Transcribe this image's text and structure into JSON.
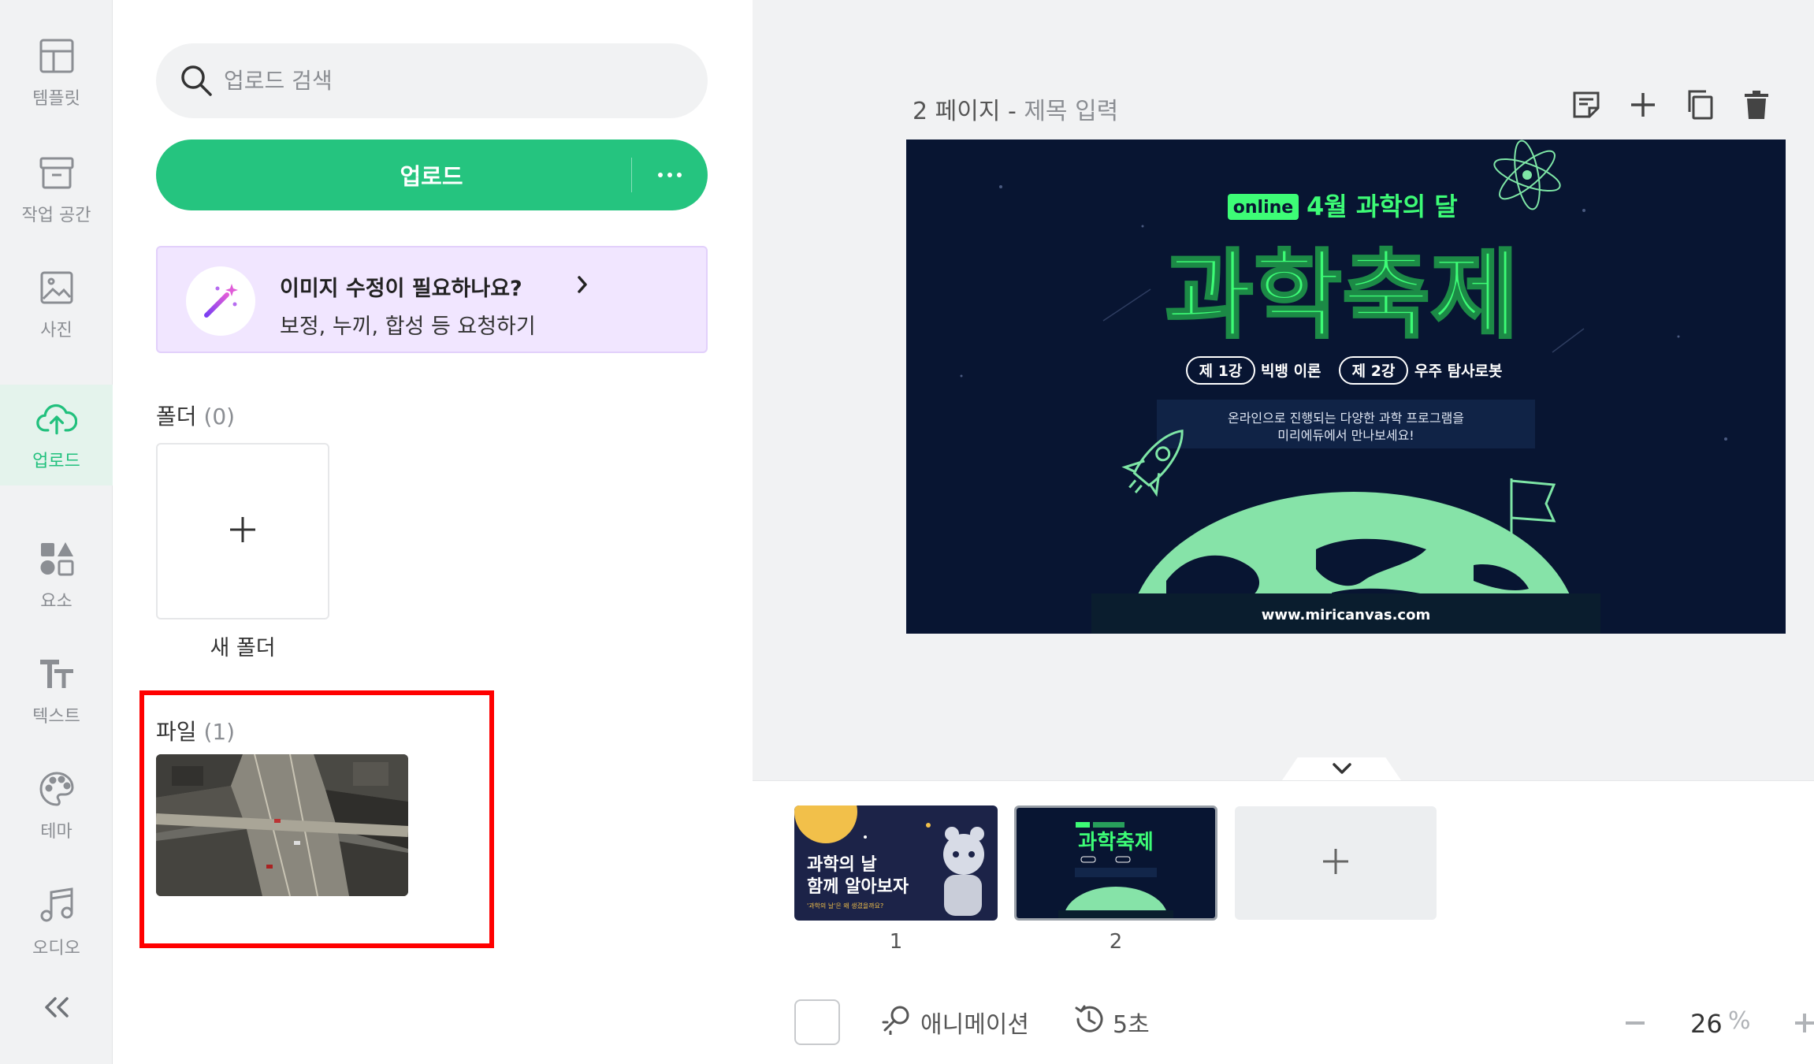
{
  "nav": {
    "items": [
      {
        "label": "템플릿",
        "icon": "template-icon"
      },
      {
        "label": "작업 공간",
        "icon": "archive-icon"
      },
      {
        "label": "사진",
        "icon": "image-icon"
      },
      {
        "label": "업로드",
        "icon": "cloud-upload-icon",
        "active": true
      },
      {
        "label": "요소",
        "icon": "shapes-icon"
      },
      {
        "label": "텍스트",
        "icon": "text-icon"
      },
      {
        "label": "테마",
        "icon": "palette-icon"
      },
      {
        "label": "오디오",
        "icon": "music-icon"
      }
    ],
    "collapse_icon": "double-chevron-left-icon"
  },
  "panel": {
    "search_placeholder": "업로드 검색",
    "upload_label": "업로드",
    "promo_title": "이미지 수정이 필요하나요?",
    "promo_sub": "보정, 누끼, 합성 등 요청하기",
    "folders_title": "폴더",
    "folders_count": "(0)",
    "new_folder_label": "새 폴더",
    "files_title": "파일",
    "files_count": "(1)"
  },
  "canvas": {
    "page_label": "2 페이지 - ",
    "title_placeholder": "제목 입력",
    "toolbar": [
      "memo-icon",
      "add-page-icon",
      "duplicate-icon",
      "trash-icon"
    ]
  },
  "slide": {
    "badge": "online",
    "subtitle": "4월 과학의 달",
    "title": "과학축제",
    "lecture1_tag": "제 1강",
    "lecture1": "빅뱅 이론",
    "lecture2_tag": "제 2강",
    "lecture2": "우주 탐사로봇",
    "desc1": "온라인으로 진행되는 다양한 과학 프로그램을",
    "desc2": "미리에듀에서 만나보세요!",
    "url": "www.miricanvas.com"
  },
  "thumbnails": {
    "slide1_line1": "과학의 날",
    "slide1_line2": "함께 알아보자",
    "slide1_foot": "'과학의 날'은 왜 생겼을까요?",
    "slide2_title": "과학축제",
    "numbers": [
      "1",
      "2"
    ]
  },
  "bottom": {
    "animation_label": "애니메이션",
    "duration_label": "5초",
    "zoom_value": "26",
    "zoom_unit": "%"
  },
  "colors": {
    "brand_green": "#25c47f",
    "slide_bg": "#081532",
    "slide_accent": "#3dfc76",
    "highlight": "#ff0000"
  }
}
